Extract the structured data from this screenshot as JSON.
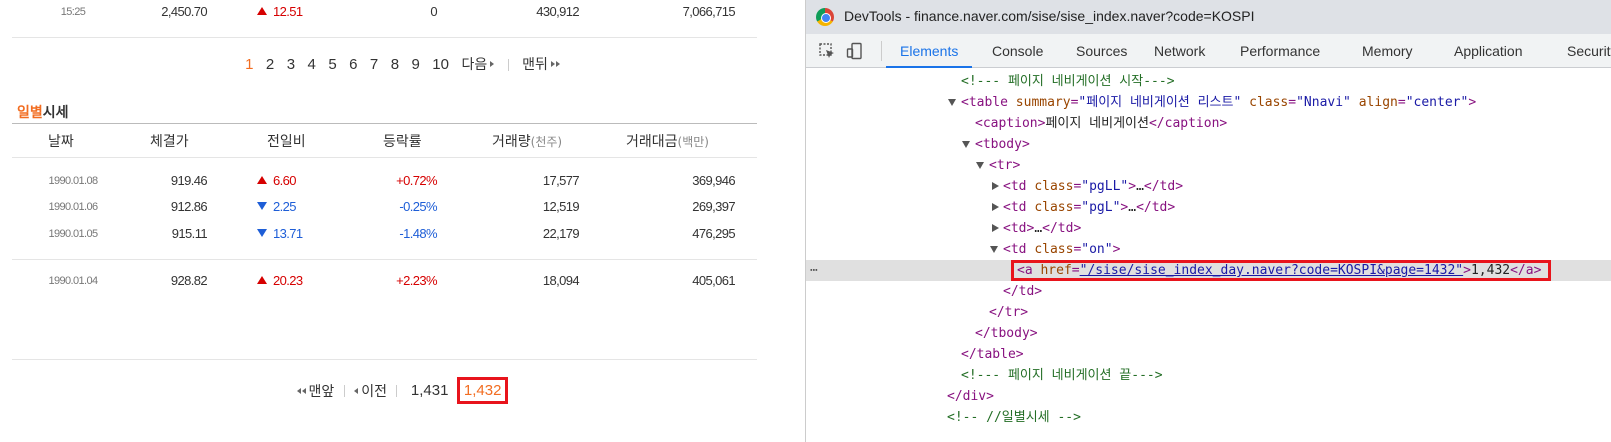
{
  "page": {
    "top_row": {
      "time": "15:25",
      "close": "2,450.70",
      "change": "12.51",
      "change_dir": "up",
      "rate": "0",
      "volume": "430,912",
      "amount": "7,066,715"
    },
    "top_pager": {
      "pages": [
        "1",
        "2",
        "3",
        "4",
        "5",
        "6",
        "7",
        "8",
        "9",
        "10"
      ],
      "current": "1",
      "next_label": "다음",
      "last_label": "맨뒤"
    },
    "section_title_part1": "일별",
    "section_title_part2": "시세",
    "headers": {
      "date": "날짜",
      "close": "체결가",
      "change": "전일비",
      "rate": "등락률",
      "volume": "거래량",
      "volume_unit": "(천주)",
      "amount": "거래대금",
      "amount_unit": "(백만)"
    },
    "rows": [
      {
        "date": "1990.01.08",
        "close": "919.46",
        "change": "6.60",
        "dir": "up",
        "rate": "+0.72%",
        "volume": "17,577",
        "amount": "369,946"
      },
      {
        "date": "1990.01.06",
        "close": "912.86",
        "change": "2.25",
        "dir": "down",
        "rate": "-0.25%",
        "volume": "12,519",
        "amount": "269,397"
      },
      {
        "date": "1990.01.05",
        "close": "915.11",
        "change": "13.71",
        "dir": "down",
        "rate": "-1.48%",
        "volume": "22,179",
        "amount": "476,295"
      },
      {
        "date": "1990.01.04",
        "close": "928.82",
        "change": "20.23",
        "dir": "up",
        "rate": "+2.23%",
        "volume": "18,094",
        "amount": "405,061"
      }
    ],
    "bottom_pager": {
      "first_label": "맨앞",
      "prev_label": "이전",
      "pages": [
        "1,431",
        "1,432"
      ],
      "current": "1,432"
    }
  },
  "devtools": {
    "title": "DevTools - finance.naver.com/sise/sise_index.naver?code=KOSPI",
    "tabs": [
      "Elements",
      "Console",
      "Sources",
      "Network",
      "Performance",
      "Memory",
      "Application",
      "Security"
    ],
    "active_tab": "Elements",
    "lines": {
      "l0": "<!--- 페이지 네비게이션 시작--->",
      "l1_tag": "table",
      "l1_a1": "summary",
      "l1_v1": "\"페이지 네비게이션 리스트\"",
      "l1_a2": "class",
      "l1_v2": "\"Nnavi\"",
      "l1_a3": "align",
      "l1_v3": "\"center\"",
      "l2_text": "페이지 네비게이션",
      "l5_v": "\"pgLL\"",
      "l6_v": "\"pgL\"",
      "l8_v": "\"on\"",
      "l9_href": "\"/sise/sise_index_day.naver?code=KOSPI&page=1432\"",
      "l9_text": "1,432",
      "l15": "<!--- 페이지 네비게이션 끝--->",
      "l17": "<!-- //일별시세 -->"
    }
  },
  "colors": {
    "accent_orange": "#f26d21",
    "up_red": "#d60000",
    "down_blue": "#1e5ed7",
    "highlight_red": "#e8141c",
    "devtools_blue": "#1a73e8"
  },
  "icons": [
    "chrome-icon",
    "inspect-element-icon",
    "device-toolbar-icon"
  ]
}
